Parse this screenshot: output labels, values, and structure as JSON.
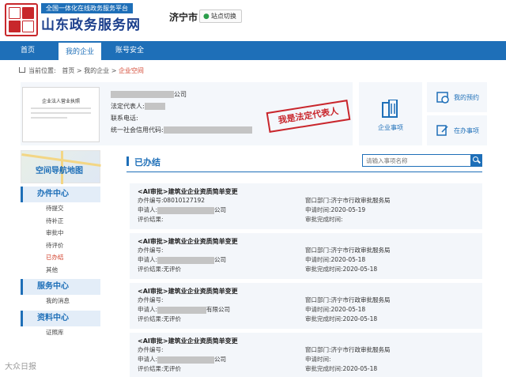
{
  "header": {
    "seal_text": "中國",
    "slogan": "全国一体化在线政务服务平台",
    "title": "山东政务服务网",
    "city": "济宁市",
    "switch_label": "站点切换"
  },
  "nav": {
    "items": [
      {
        "label": "首页"
      },
      {
        "label": "我的企业"
      },
      {
        "label": "账号安全"
      }
    ],
    "active_index": 1
  },
  "breadcrumb": {
    "prefix": "当前位置:",
    "items": [
      "首页",
      "我的企业",
      "企业空间"
    ],
    "separator": ">"
  },
  "company": {
    "name_suffix": "公司",
    "license_title": "企业法人营业执照",
    "legal_rep_label": "法定代表人:",
    "phone_label": "联系电话:",
    "credit_code_label": "统一社会信用代码:",
    "stamp": "我是法定代表人"
  },
  "tiles": {
    "enterprise_matters": "企业事项",
    "my_appointments": "我的预约",
    "online_matters": "在办事项"
  },
  "sidebar": {
    "map_title": "空间导航地图",
    "sections": [
      {
        "title": "办件中心",
        "items": [
          "待提交",
          "待补正",
          "审批中",
          "待评价",
          "已办结",
          "其他"
        ]
      },
      {
        "title": "服务中心",
        "items": [
          "我的消息"
        ]
      },
      {
        "title": "资料中心",
        "items": [
          "证照库"
        ]
      }
    ],
    "active_item": "已办结"
  },
  "main": {
    "section_title": "已办结",
    "search_placeholder": "请输入事项名称"
  },
  "cards": [
    {
      "title": "<AI审批>建筑业企业资质简单变更",
      "number_label": "办件编号:",
      "number": "08010127192",
      "applicant_label": "申请人:",
      "applicant_suffix": "公司",
      "eval_label": "评价结果:",
      "eval": "",
      "dept_label": "窗口部门:",
      "dept": "济宁市行政审批服务局",
      "apply_time_label": "申请时间:",
      "apply_time": "2020-05-19",
      "done_time_label": "审批完成时间:",
      "done_time": ""
    },
    {
      "title": "<AI审批>建筑业企业资质简单变更",
      "number_label": "办件编号:",
      "number": "",
      "applicant_label": "申请人:",
      "applicant_suffix": "公司",
      "eval_label": "评价结果:",
      "eval": "无评价",
      "dept_label": "窗口部门:",
      "dept": "济宁市行政审批服务局",
      "apply_time_label": "申请时间:",
      "apply_time": "2020-05-18",
      "done_time_label": "审批完成时间:",
      "done_time": "2020-05-18"
    },
    {
      "title": "<AI审批>建筑业企业资质简单变更",
      "number_label": "办件编号:",
      "number": "",
      "applicant_label": "申请人:",
      "applicant_suffix": "有限公司",
      "eval_label": "评价结果:",
      "eval": "无评价",
      "dept_label": "窗口部门:",
      "dept": "济宁市行政审批服务局",
      "apply_time_label": "申请时间:",
      "apply_time": "2020-05-18",
      "done_time_label": "审批完成时间:",
      "done_time": "2020-05-18"
    },
    {
      "title": "<AI审批>建筑业企业资质简单变更",
      "number_label": "办件编号:",
      "number": "",
      "applicant_label": "申请人:",
      "applicant_suffix": "公司",
      "eval_label": "评价结果:",
      "eval": "无评价",
      "dept_label": "窗口部门:",
      "dept": "济宁市行政审批服务局",
      "apply_time_label": "申请时间:",
      "apply_time": "",
      "done_time_label": "审批完成时间:",
      "done_time": "2020-05-18"
    }
  ],
  "watermark": "大众日报",
  "colors": {
    "primary": "#1e6fb8",
    "accent_red": "#c9262c",
    "panel": "#f4f7fb"
  }
}
